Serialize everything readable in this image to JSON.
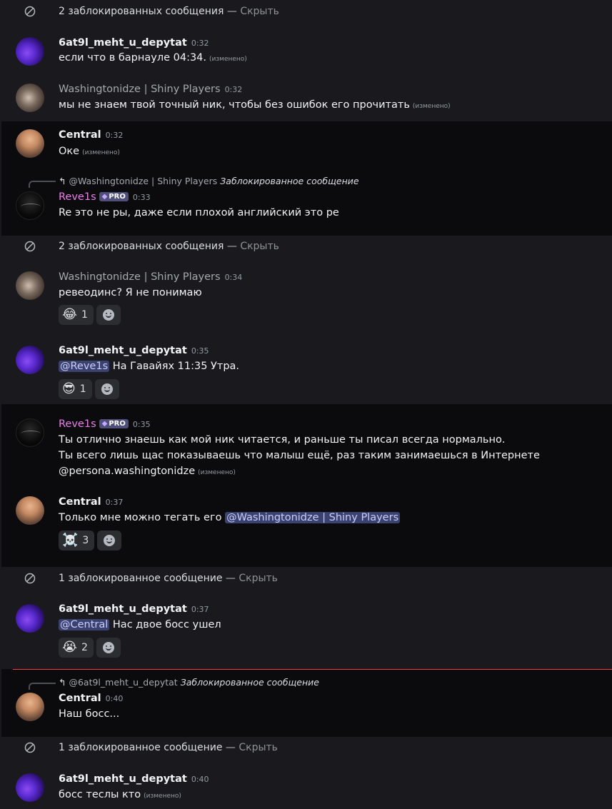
{
  "blocked_notices": [
    {
      "text": "2 заблокированных сообщения",
      "sep": "—",
      "hide": "Скрыть"
    },
    {
      "text": "2 заблокированных сообщения",
      "sep": "—",
      "hide": "Скрыть"
    },
    {
      "text": "1 заблокированное сообщение",
      "sep": "—",
      "hide": "Скрыть"
    },
    {
      "text": "1 заблокированное сообщение",
      "sep": "—",
      "hide": "Скрыть"
    }
  ],
  "messages": [
    {
      "author": "6at9l_meht_u_depytat",
      "time": "0:32",
      "text": "если что в барнауле 04:34.",
      "edited": "(изменено)"
    },
    {
      "author": "Washingtonidze | Shiny Players",
      "time": "0:32",
      "text": "мы не знаем твой точный ник, чтобы без ошибок его прочитать",
      "edited": "(изменено)"
    },
    {
      "author": "Central",
      "time": "0:32",
      "text": "Оке",
      "edited": "(изменено)"
    },
    {
      "reply_to": "@Washingtonidze | Shiny Players",
      "reply_blocked": "Заблокированное сообщение",
      "author": "Reve1s",
      "badge": "PRO",
      "time": "0:33",
      "text": "Re это не ры, даже если плохой английский это ре"
    },
    {
      "author": "Washingtonidze | Shiny Players",
      "time": "0:34",
      "text": "ревеодинс? Я не понимаю",
      "reaction": {
        "emoji": "😂",
        "count": "1"
      }
    },
    {
      "author": "6at9l_meht_u_depytat",
      "time": "0:35",
      "mention": "@Reve1s",
      "text": " На Гавайях 11:35 Утра.",
      "reaction": {
        "emoji": "😎",
        "count": "1"
      }
    },
    {
      "author": "Reve1s",
      "badge": "PRO",
      "time": "0:35",
      "lines": [
        "Ты отлично знаешь как мой ник читается, и раньше ты писал всегда нормально.",
        "Ты всего лишь щас показываешь что малыш ещё,  раз таким занимаешься в Интернете",
        "@persona.washingtonidze"
      ],
      "edited": "(изменено)"
    },
    {
      "author": "Central",
      "time": "0:37",
      "text": "Только мне можно тегать его ",
      "mention": "@Washingtonidze | Shiny Players",
      "reaction": {
        "emoji": "☠️",
        "count": "3"
      }
    },
    {
      "author": "6at9l_meht_u_depytat",
      "time": "0:37",
      "mention": "@Central",
      "text": " Нас двое босс ушел",
      "reaction": {
        "emoji": "😭",
        "count": "2"
      }
    },
    {
      "reply_to": "@6at9l_meht_u_depytat",
      "reply_blocked": "Заблокированное сообщение",
      "author": "Central",
      "time": "0:40",
      "text": "Наш босс..."
    },
    {
      "author": "6at9l_meht_u_depytat",
      "time": "0:40",
      "text": "босс теслы кто",
      "edited": "(изменено)"
    }
  ],
  "icons": {
    "blocked": "blocked-circle-icon",
    "reply": "reply-arrow-icon",
    "add_reaction": "add-reaction-icon",
    "badge_gem": "gem-icon"
  },
  "colors": {
    "background": "#1a1a1e",
    "highlight_band": "#0b0b0d",
    "username_pink": "#e97ee8",
    "mention_bg": "#3c4270",
    "new_messages_line": "#f23f43"
  }
}
